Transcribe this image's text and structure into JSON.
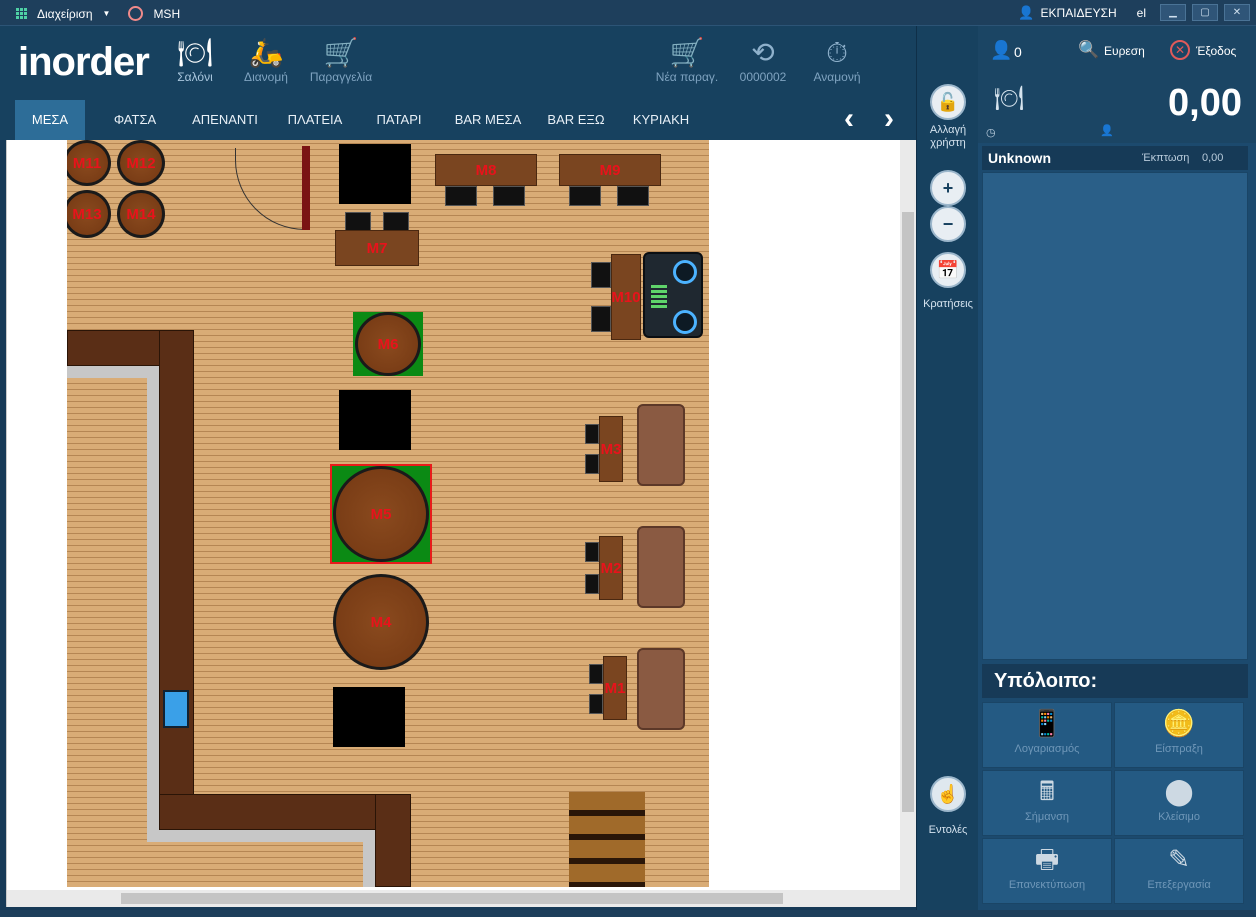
{
  "titlebar": {
    "menu_label": "Διαχείριση",
    "profile_label": "MSH",
    "user_label": "ΕΚΠΑΙΔΕΥΣΗ",
    "lang": "el"
  },
  "header": {
    "logo": "inorder",
    "nav": [
      {
        "label": "Σαλόνι",
        "icon": "dining-icon"
      },
      {
        "label": "Διανομή",
        "icon": "delivery-icon"
      },
      {
        "label": "Παραγγελία",
        "icon": "cart-icon"
      },
      {
        "label": "Νέα παραγ.",
        "icon": "new-order-icon"
      },
      {
        "label": "0000002",
        "icon": "history-icon"
      },
      {
        "label": "Αναμονή",
        "icon": "stopwatch-icon"
      }
    ]
  },
  "tabs": [
    "ΜΕΣΑ",
    "ΦΑΤΣΑ",
    "ΑΠΕΝΑΝΤΙ",
    "ΠΛΑΤΕΙΑ",
    "ΠΑΤΑΡΙ",
    "BAR ΜΕΣΑ",
    "BAR ΕΞΩ",
    "ΚΥΡΙΑΚΗ"
  ],
  "tables": {
    "M1": "M1",
    "M2": "M2",
    "M3": "M3",
    "M4": "M4",
    "M5": "M5",
    "M6": "M6",
    "M7": "M7",
    "M8": "M8",
    "M9": "M9",
    "M10": "M10",
    "M11": "M11",
    "M12": "M12",
    "M13": "M13",
    "M14": "M14"
  },
  "middle": {
    "lock_label": "Αλλαγή χρήστη",
    "reservations_label": "Κρατήσεις",
    "commands_label": "Εντολές"
  },
  "right": {
    "guests": "0",
    "search_label": "Ευρεση",
    "exit_label": "Έξοδος",
    "total": "0,00",
    "customer": "Unknown",
    "discount_label": "Έκπτωση",
    "discount_value": "0,00",
    "balance_label": "Υπόλοιπο:",
    "actions": [
      "Λογαριασμός",
      "Είσπραξη",
      "Σήμανση",
      "Κλείσιμο",
      "Επανεκτύπωση",
      "Επεξεργασία"
    ]
  }
}
